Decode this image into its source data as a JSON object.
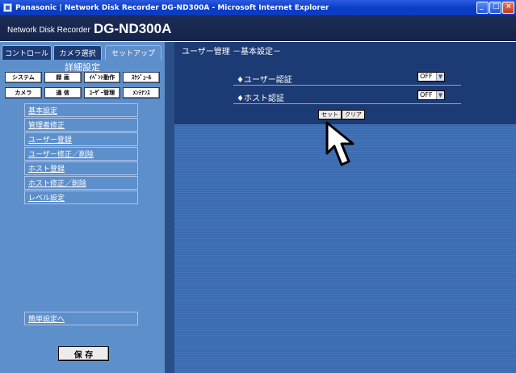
{
  "window": {
    "title": "Panasonic | Network Disk Recorder DG-ND300A - Microsoft Internet Explorer"
  },
  "header": {
    "small_label": "Network Disk Recorder",
    "model": "DG-ND300A"
  },
  "left": {
    "tabs": [
      "コントロール",
      "カメラ選択",
      "セットアップ"
    ],
    "section_title": "詳細設定",
    "row1": [
      "システム",
      "録 画",
      "ｲﾍﾞﾝﾄ動作",
      "ｽｹｼﾞｭｰﾙ"
    ],
    "row2": [
      "カメラ",
      "通 信",
      "ﾕｰｻﾞｰ管理",
      "ﾒﾝﾃﾅﾝｽ"
    ],
    "menu": [
      "基本設定",
      "管理者修正",
      "ユーザー登録",
      "ユーザー修正／削除",
      "ホスト登録",
      "ホスト修正／削除",
      "レベル設定"
    ],
    "simple_link": "簡単設定へ",
    "save": "保 存"
  },
  "main": {
    "title": "ユーザー管理 －基本設定－",
    "rows": [
      {
        "label": "♦ユーザー認証",
        "value": "OFF"
      },
      {
        "label": "♦ホスト認証",
        "value": "OFF"
      }
    ],
    "set_button": "セット",
    "clear_button": "クリア"
  },
  "colors": {
    "titlebar": "#0a3ec9",
    "panel": "#5d8fcb",
    "dark_navy": "#1c3a73",
    "content_bg": "#3b6bb0"
  }
}
